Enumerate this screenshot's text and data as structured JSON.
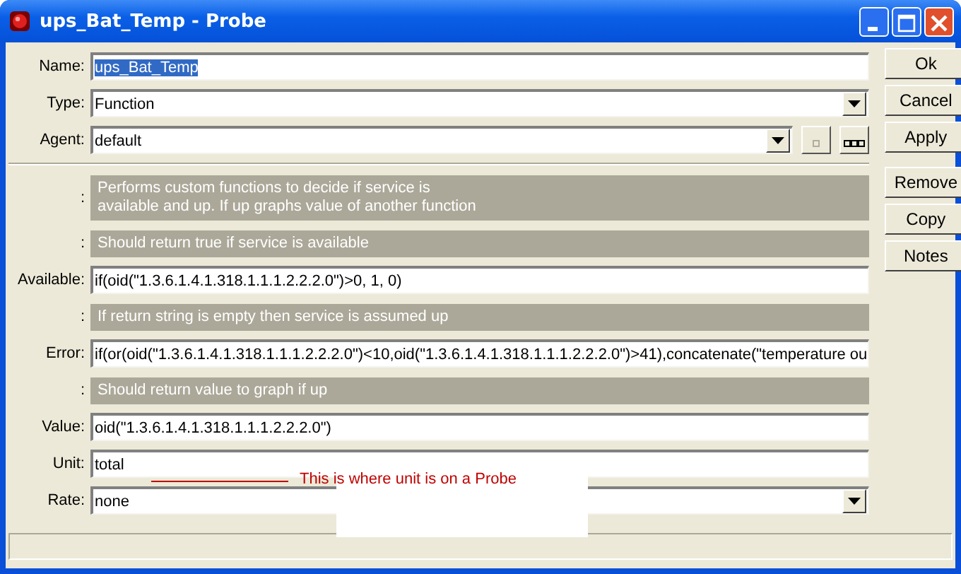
{
  "window": {
    "title": "ups_Bat_Temp - Probe"
  },
  "rows": [
    {
      "kind": "text",
      "label": "Name:",
      "value": "ups_Bat_Temp",
      "highlighted": true
    },
    {
      "kind": "dropdown",
      "label": "Type:",
      "value": "Function"
    },
    {
      "kind": "dropdown-browse",
      "label": "Agent:",
      "value": "default"
    },
    {
      "kind": "separator"
    },
    {
      "kind": "info",
      "label": ":",
      "text": "Performs custom functions to decide if service is available and up. If up graphs value of another function"
    },
    {
      "kind": "info",
      "label": ":",
      "text": "Should return true if service is available"
    },
    {
      "kind": "text",
      "label": "Available:",
      "value": "if(oid(\"1.3.6.1.4.1.318.1.1.1.2.2.2.0\")>0, 1, 0)",
      "highlighted": false
    },
    {
      "kind": "info",
      "label": ":",
      "text": "If return string is empty then service is assumed up"
    },
    {
      "kind": "text",
      "label": "Error:",
      "value": "if(or(oid(\"1.3.6.1.4.1.318.1.1.1.2.2.2.0\")<10,oid(\"1.3.6.1.4.1.318.1.1.1.2.2.2.0\")>41),concatenate(\"temperature ou",
      "highlighted": false
    },
    {
      "kind": "info",
      "label": ":",
      "text": "Should return value to graph if up"
    },
    {
      "kind": "text",
      "label": "Value:",
      "value": "oid(\"1.3.6.1.4.1.318.1.1.1.2.2.2.0\")",
      "highlighted": false
    },
    {
      "kind": "text",
      "label": "Unit:",
      "value": "total",
      "highlighted": false
    },
    {
      "kind": "dropdown",
      "label": "Rate:",
      "value": "none"
    }
  ],
  "button_groups": [
    [
      "Ok",
      "Cancel",
      "Apply"
    ],
    [
      "Remove",
      "Copy",
      "Notes"
    ]
  ],
  "annotation": {
    "text": "This is where unit is on a Probe"
  }
}
